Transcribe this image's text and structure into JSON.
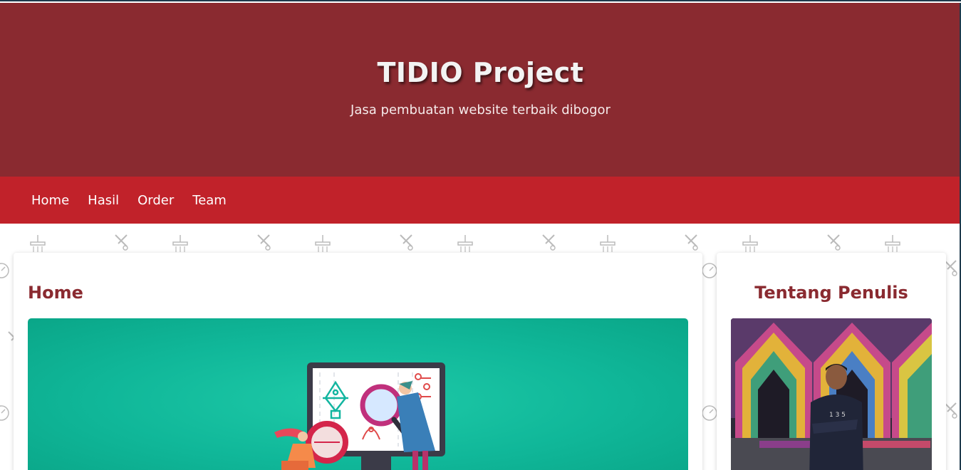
{
  "header": {
    "title": "TIDIO Project",
    "tagline": "Jasa pembuatan website terbaik dibogor"
  },
  "nav": {
    "items": [
      {
        "label": "Home"
      },
      {
        "label": "Hasil"
      },
      {
        "label": "Order"
      },
      {
        "label": "Team"
      }
    ]
  },
  "main": {
    "title": "Home",
    "hero_image": "web-design-illustration"
  },
  "sidebar": {
    "title": "Tentang Penulis",
    "photo": "author-photo"
  },
  "colors": {
    "header_bg": "#8a2a30",
    "nav_bg": "#c1222a",
    "heading": "#8a2a30",
    "hero_bg": "#10b799"
  }
}
